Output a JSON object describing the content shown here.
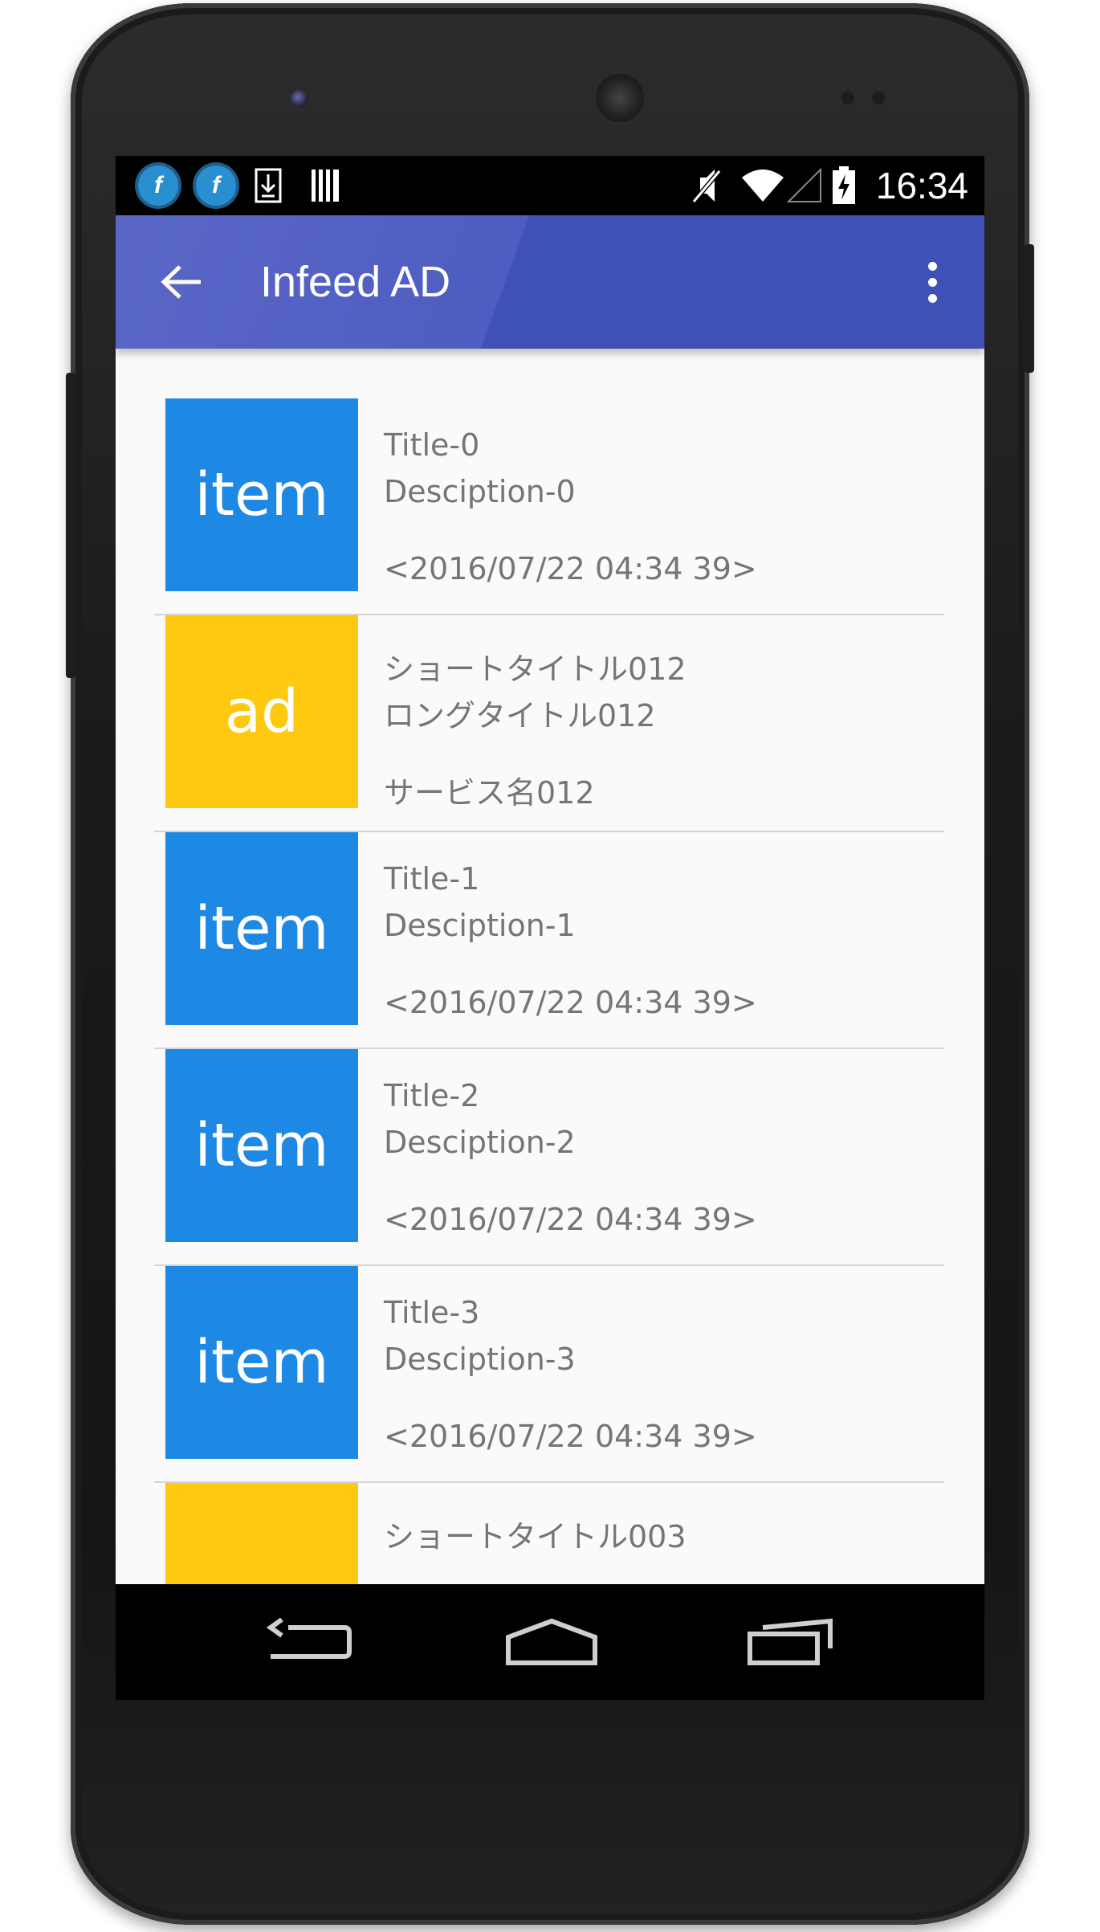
{
  "status_bar": {
    "time": "16:34",
    "icons": [
      "app-notification-icon",
      "app-notification-icon",
      "download-icon",
      "barcode-icon",
      "mute-icon",
      "wifi-icon",
      "signal-icon",
      "battery-charging-icon"
    ]
  },
  "app_bar": {
    "title": "Infeed AD",
    "background_color": "#3f51b5",
    "back_icon": "arrow-left-icon",
    "menu_icon": "more-vert-icon"
  },
  "list": {
    "items": [
      {
        "type": "item",
        "thumb_label": "item",
        "title": "Title-0",
        "description": "Desciption-0",
        "meta": "<2016/07/22 04:34 39>"
      },
      {
        "type": "ad",
        "thumb_label": "ad",
        "title": "ショートタイトル012",
        "description": "ロングタイトル012",
        "meta": "サービス名012"
      },
      {
        "type": "item",
        "thumb_label": "item",
        "title": "Title-1",
        "description": "Desciption-1",
        "meta": "<2016/07/22 04:34 39>"
      },
      {
        "type": "item",
        "thumb_label": "item",
        "title": "Title-2",
        "description": "Desciption-2",
        "meta": "<2016/07/22 04:34 39>"
      },
      {
        "type": "item",
        "thumb_label": "item",
        "title": "Title-3",
        "description": "Desciption-3",
        "meta": "<2016/07/22 04:34 39>"
      },
      {
        "type": "ad",
        "thumb_label": "",
        "title": "ショートタイトル003",
        "description": "",
        "meta": ""
      }
    ],
    "item_color": "#1e88e5",
    "ad_color": "#ffc910"
  },
  "nav_bar": {
    "buttons": [
      "back-icon",
      "home-icon",
      "recents-icon"
    ]
  }
}
